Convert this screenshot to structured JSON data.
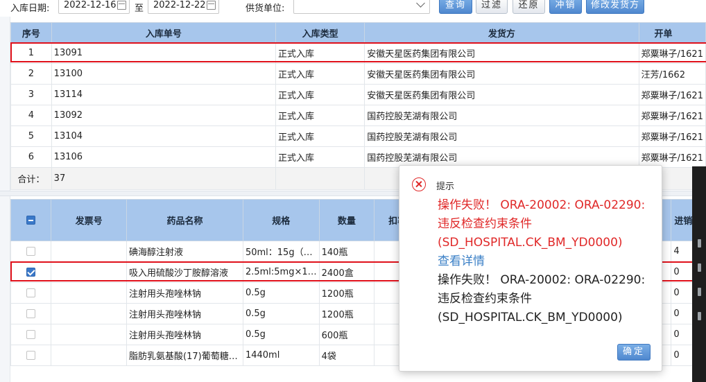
{
  "toolbar": {
    "date_label": "入库日期:",
    "date_from": "2022-12-16",
    "to_label": "至",
    "date_to": "2022-12-22",
    "supplier_label": "供货单位:",
    "supplier_value": "",
    "btn_query": "查询",
    "btn_filter": "过滤",
    "btn_restore": "还原",
    "btn_reverse": "冲销",
    "btn_edit_supplier": "修改发货方"
  },
  "receipt_table": {
    "headers": [
      "序号",
      "入库单号",
      "入库类型",
      "发货方",
      "开单"
    ],
    "rows": [
      {
        "no": "1",
        "receipt_no": "13091",
        "type": "正式入库",
        "supplier": "安徽天星医药集团有限公司",
        "creator": "郑粟琳子/1621"
      },
      {
        "no": "2",
        "receipt_no": "13100",
        "type": "正式入库",
        "supplier": "安徽天星医药集团有限公司",
        "creator": "汪芳/1662"
      },
      {
        "no": "3",
        "receipt_no": "13114",
        "type": "正式入库",
        "supplier": "安徽天星医药集团有限公司",
        "creator": "郑粟琳子/1621"
      },
      {
        "no": "4",
        "receipt_no": "13092",
        "type": "正式入库",
        "supplier": "国药控股芜湖有限公司",
        "creator": "郑粟琳子/1621"
      },
      {
        "no": "5",
        "receipt_no": "13104",
        "type": "正式入库",
        "supplier": "国药控股芜湖有限公司",
        "creator": "郑粟琳子/1621"
      },
      {
        "no": "6",
        "receipt_no": "13106",
        "type": "正式入库",
        "supplier": "国药控股芜湖有限公司",
        "creator": "郑粟琳子/1621"
      }
    ],
    "summary_label": "合计：",
    "summary_count": "37"
  },
  "detail_table": {
    "headers": [
      "",
      "发票号",
      "药品名称",
      "规格",
      "数量",
      "扣率",
      "进销"
    ],
    "rows": [
      {
        "checked": false,
        "invoice": "",
        "drug": "碘海醇注射液",
        "spec": "50ml：15g（…",
        "qty": "140瓶",
        "right": "4"
      },
      {
        "checked": true,
        "invoice": "",
        "drug": "吸入用硫酸沙丁胺醇溶液",
        "spec": "2.5ml:5mg×1…",
        "qty": "2400盒",
        "right": "0"
      },
      {
        "checked": false,
        "invoice": "",
        "drug": "注射用头孢唑林钠",
        "spec": "0.5g",
        "qty": "1200瓶",
        "right": "0"
      },
      {
        "checked": false,
        "invoice": "",
        "drug": "注射用头孢唑林钠",
        "spec": "0.5g",
        "qty": "1200瓶",
        "right": "0"
      },
      {
        "checked": false,
        "invoice": "",
        "drug": "注射用头孢唑林钠",
        "spec": "0.5g",
        "qty": "600瓶",
        "right": "0"
      },
      {
        "checked": false,
        "invoice": "",
        "drug": "脂肪乳氨基酸(17)葡萄糖…",
        "spec": "1440ml",
        "qty": "4袋",
        "right": "0"
      }
    ]
  },
  "dialog": {
    "title": "提示",
    "error_line1": "操作失败！ ORA-20002: ORA-02290:",
    "error_line2": "违反检查约束条件",
    "error_line3": "(SD_HOSPITAL.CK_BM_YD0000)",
    "details_link": "查看详情",
    "detail_line1": "操作失败！ ORA-20002: ORA-02290:",
    "detail_line2": "违反检查约束条件",
    "detail_line3": "(SD_HOSPITAL.CK_BM_YD0000)",
    "ok_label": "确定",
    "icon": "error-circle-x-icon",
    "error_color": "#e02828"
  },
  "colors": {
    "header_bg": "#a7c6ec",
    "button_blue": "#4f88cf",
    "selection_outline": "#e0101a"
  }
}
